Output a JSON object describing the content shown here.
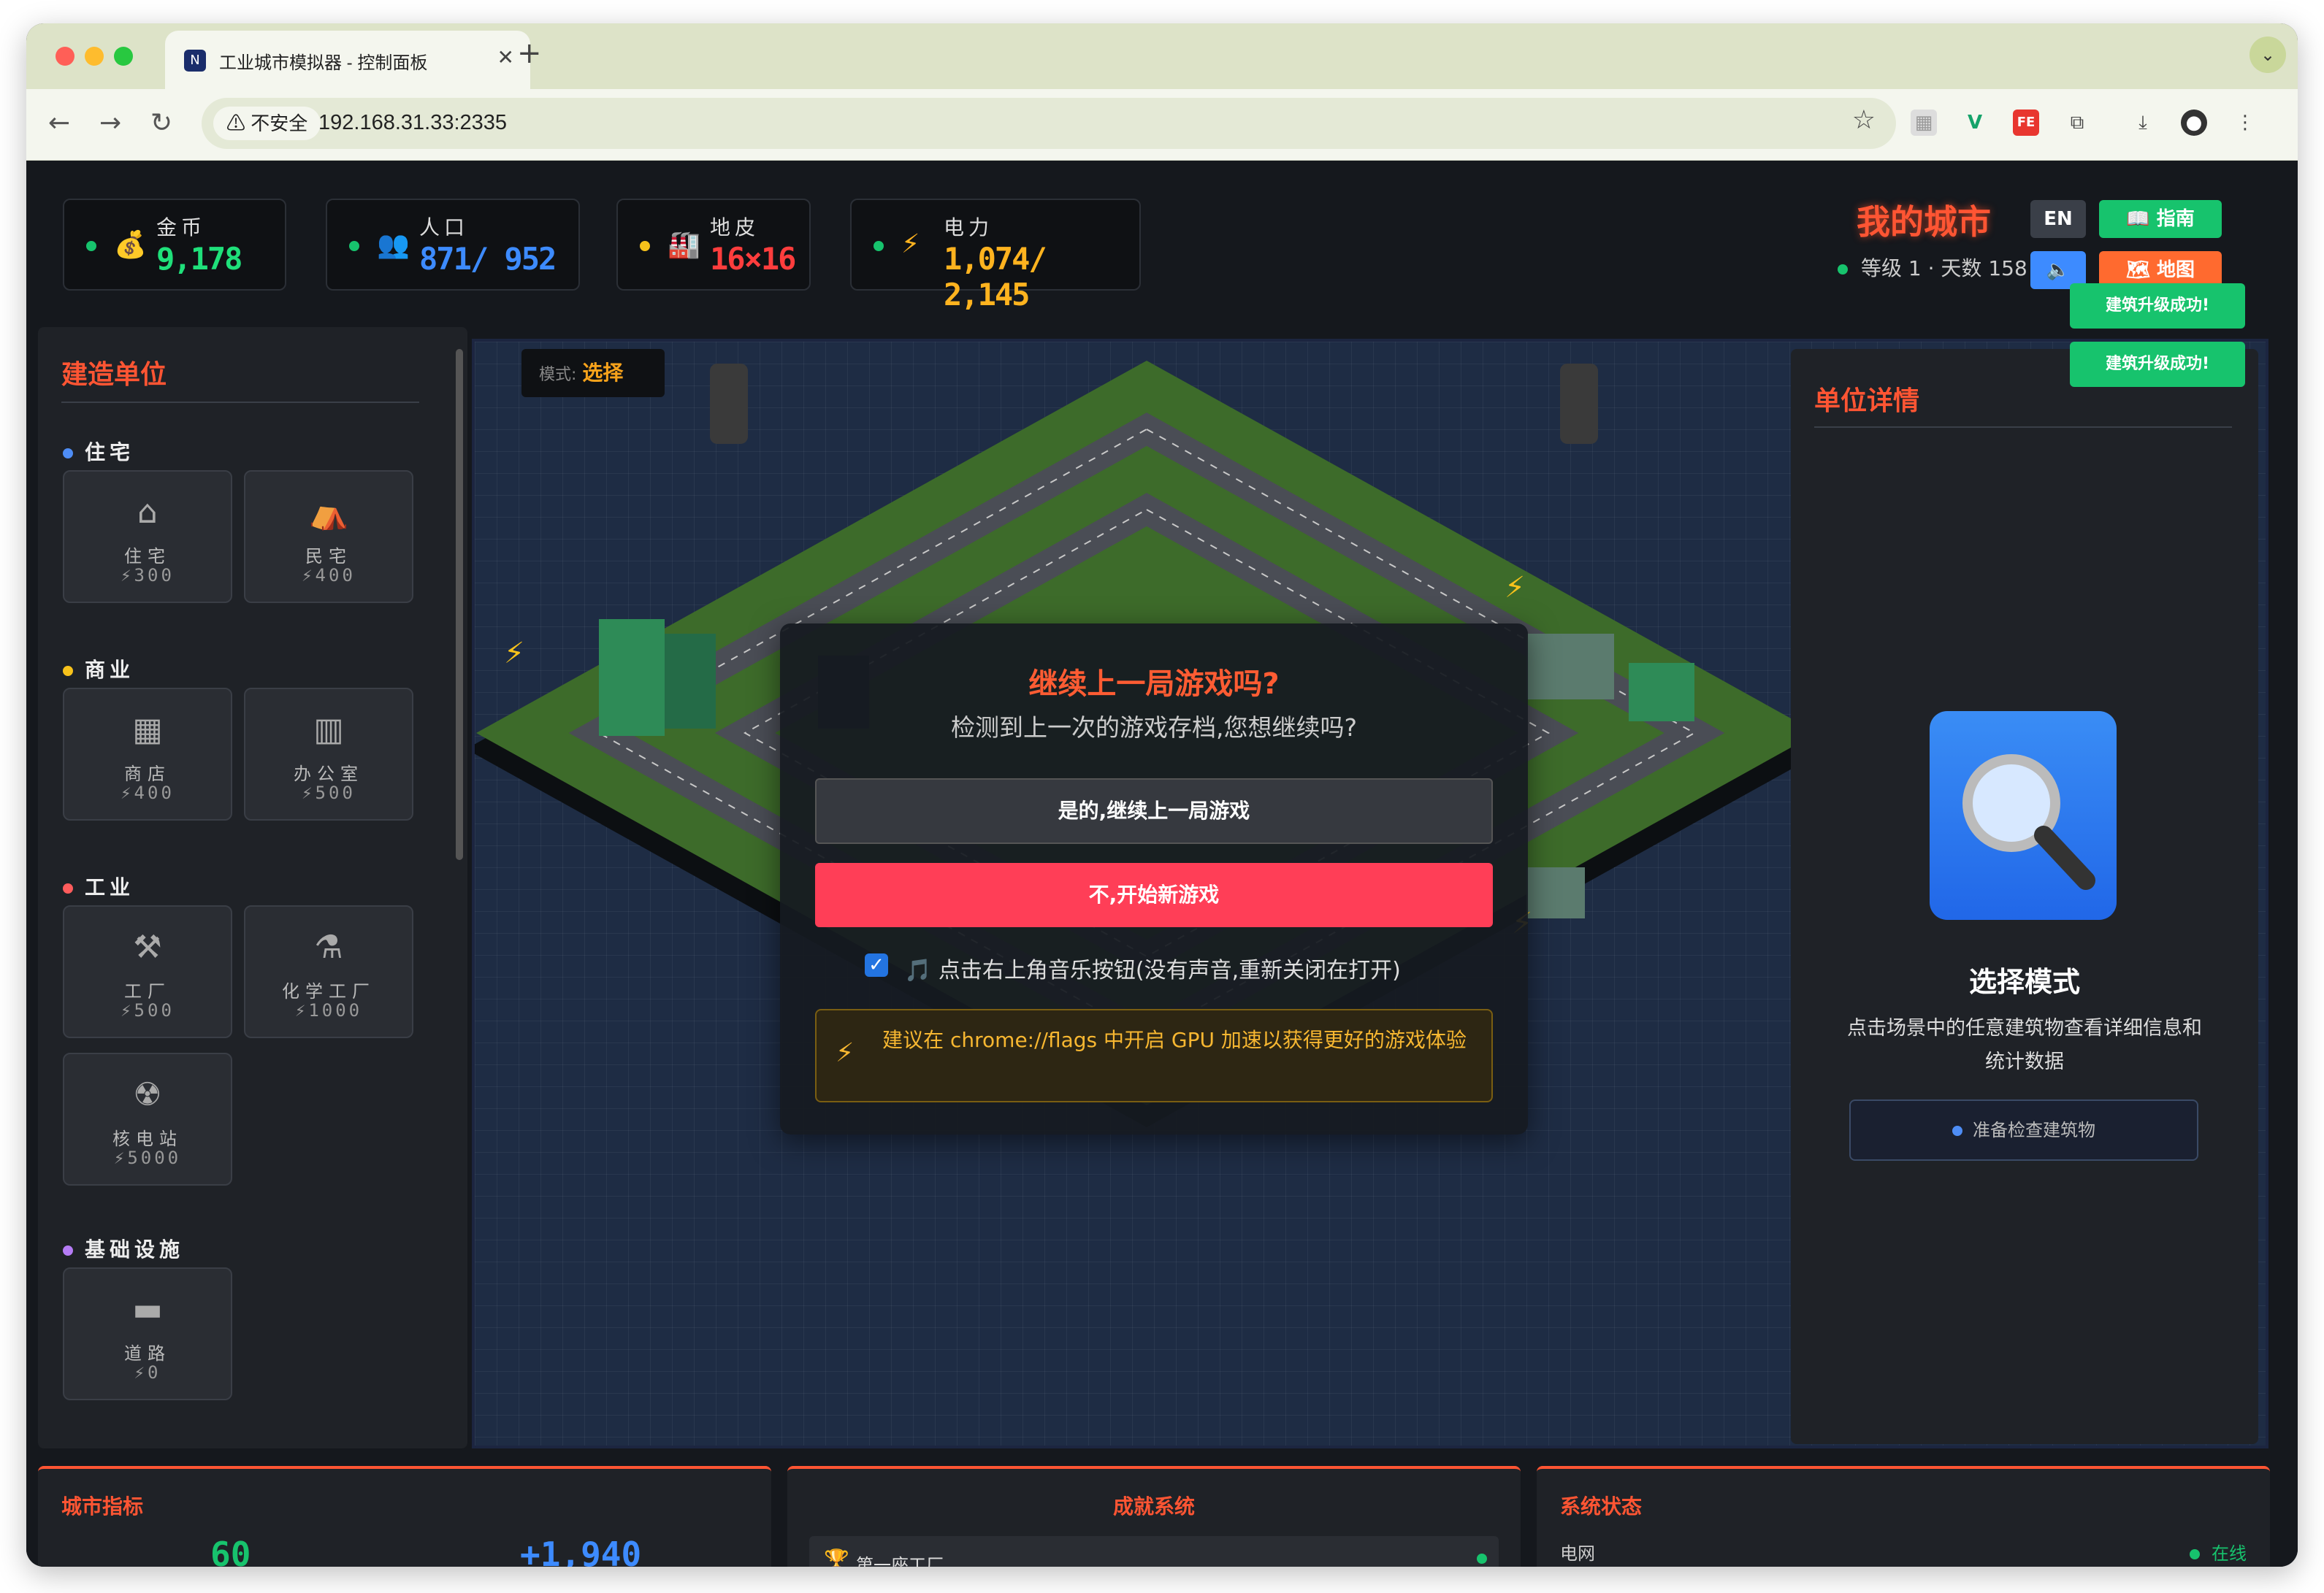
{
  "browser": {
    "tab_title": "工业城市模拟器 - 控制面板",
    "security_label": "不安全",
    "url": "192.168.31.33:2335"
  },
  "stats": [
    {
      "label": "金币",
      "value": "9,178",
      "color": "#1fe07a",
      "dot": "#17c36d",
      "icon": "money-bag-icon"
    },
    {
      "label": "人口",
      "value": "871/ 952",
      "color": "#3d8bff",
      "dot": "#17c36d",
      "icon": "people-icon"
    },
    {
      "label": "地皮",
      "value": "16×16",
      "color": "#ff3d3d",
      "dot": "#f7c21b",
      "icon": "factory-icon"
    },
    {
      "label": "电力",
      "value": "1,074/ 2,145",
      "color": "#ffb31f",
      "dot": "#17c36d",
      "icon": "lightning-icon"
    }
  ],
  "header": {
    "city_name": "我的城市",
    "city_sub": "等级 1 · 天数 158",
    "lang_button": "EN",
    "guide_button": "📖 指南",
    "map_button": "🗺 地图",
    "toasts": [
      "建筑升级成功!",
      "建筑升级成功!"
    ]
  },
  "left_panel": {
    "title": "建造单位",
    "categories": [
      {
        "name": "住宅",
        "color": "#4e8df5"
      },
      {
        "name": "商业",
        "color": "#f7c21b"
      },
      {
        "name": "工业",
        "color": "#ff5c5c"
      },
      {
        "name": "基础设施",
        "color": "#b57cf5"
      }
    ],
    "buildings": [
      {
        "name": "住宅",
        "price": "⚡300",
        "icon": "house-icon"
      },
      {
        "name": "民宅",
        "price": "⚡400",
        "icon": "hut-icon"
      },
      {
        "name": "商店",
        "price": "⚡400",
        "icon": "shop-icon"
      },
      {
        "name": "办公室",
        "price": "⚡500",
        "icon": "office-icon"
      },
      {
        "name": "工厂",
        "price": "⚡500",
        "icon": "factory-icon"
      },
      {
        "name": "化学工厂",
        "price": "⚡1000",
        "icon": "test-tube-icon"
      },
      {
        "name": "核电站",
        "price": "⚡5000",
        "icon": "radiation-icon"
      },
      {
        "name": "道路",
        "price": "⚡0",
        "icon": "road-icon"
      }
    ]
  },
  "map": {
    "mode_label": "模式:",
    "mode_value": "选择"
  },
  "dialog": {
    "title": "继续上一局游戏吗?",
    "subtitle": "检测到上一次的游戏存档,您想继续吗?",
    "yes_button": "是的,继续上一局游戏",
    "no_button": "不,开始新游戏",
    "music_checkbox": "🎵 点击右上角音乐按钮(没有声音,重新关闭在打开)",
    "tip": "建议在 chrome://flags 中开启 GPU 加速以获得更好的游戏体验"
  },
  "right_panel": {
    "title": "单位详情",
    "mode_title": "选择模式",
    "mode_desc": "点击场景中的任意建筑物查看详细信息和统计数据",
    "status": "准备检查建筑物"
  },
  "bottom": {
    "metrics_title": "城市指标",
    "metric_a": "60",
    "metric_b": "+1,940",
    "achievements_title": "成就系统",
    "achievement_1": "第一座工厂",
    "system_title": "系统状态",
    "system_row_label": "电网",
    "system_row_value": "在线"
  }
}
